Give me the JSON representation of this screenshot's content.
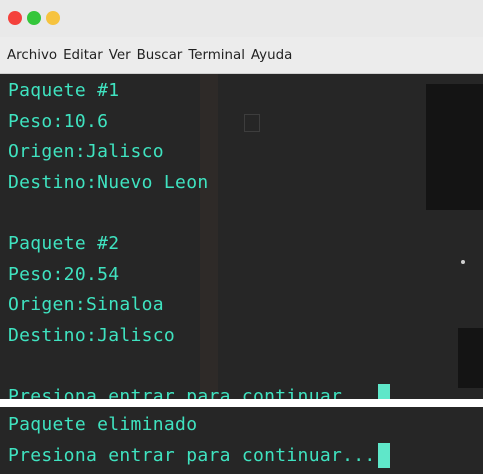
{
  "menu": [
    "Archivo",
    "Editar",
    "Ver",
    "Buscar",
    "Terminal",
    "Ayuda"
  ],
  "terminal1": {
    "lines": [
      "Paquete #1",
      "Peso:10.6",
      "Origen:Jalisco",
      "Destino:Nuevo Leon",
      "",
      "Paquete #2",
      "Peso:20.54",
      "Origen:Sinaloa",
      "Destino:Jalisco",
      "",
      "Presiona entrar para continuar..."
    ]
  },
  "terminal2": {
    "lines": [
      "Paquete eliminado",
      "Presiona entrar para continuar..."
    ]
  },
  "colors": {
    "text": "#3fe3c0",
    "background": "#262626",
    "cursor": "#5fe7c9"
  }
}
